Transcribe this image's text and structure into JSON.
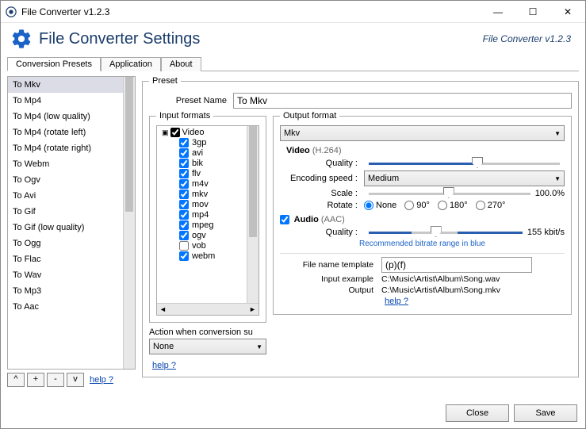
{
  "window": {
    "title": "File Converter v1.2.3",
    "minimize": "—",
    "maximize": "☐",
    "close": "✕"
  },
  "header": {
    "title": "File Converter Settings",
    "version": "File Converter v1.2.3"
  },
  "tabs": {
    "presets": "Conversion Presets",
    "application": "Application",
    "about": "About"
  },
  "presets": {
    "items": [
      "To Mkv",
      "To Mp4",
      "To Mp4 (low quality)",
      "To Mp4 (rotate left)",
      "To Mp4 (rotate right)",
      "To Webm",
      "To Ogv",
      "To Avi",
      "To Gif",
      "To Gif (low quality)",
      "To Ogg",
      "To Flac",
      "To Wav",
      "To Mp3",
      "To Aac"
    ],
    "btn_up": "^",
    "btn_add": "+",
    "btn_remove": "-",
    "btn_down": "v",
    "help": "help ?"
  },
  "preset_panel": {
    "legend": "Preset",
    "name_label": "Preset Name",
    "name_value": "To Mkv"
  },
  "input_formats": {
    "legend": "Input formats",
    "root": "Video",
    "items": [
      {
        "label": "3gp",
        "checked": true
      },
      {
        "label": "avi",
        "checked": true
      },
      {
        "label": "bik",
        "checked": true
      },
      {
        "label": "flv",
        "checked": true
      },
      {
        "label": "m4v",
        "checked": true
      },
      {
        "label": "mkv",
        "checked": true
      },
      {
        "label": "mov",
        "checked": true
      },
      {
        "label": "mp4",
        "checked": true
      },
      {
        "label": "mpeg",
        "checked": true
      },
      {
        "label": "ogv",
        "checked": true
      },
      {
        "label": "vob",
        "checked": false
      },
      {
        "label": "webm",
        "checked": true
      }
    ],
    "action_label": "Action when conversion su",
    "action_value": "None",
    "help": "help ?"
  },
  "output": {
    "legend": "Output format",
    "format_value": "Mkv",
    "video_label": "Video",
    "video_codec": "(H.264)",
    "quality_label": "Quality :",
    "encoding_label": "Encoding speed :",
    "encoding_value": "Medium",
    "scale_label": "Scale :",
    "scale_value": "100.0%",
    "rotate_label": "Rotate :",
    "rotate_options": [
      "None",
      "90°",
      "180°",
      "270°"
    ],
    "audio_label": "Audio",
    "audio_codec": "(AAC)",
    "audio_quality_label": "Quality :",
    "audio_quality_value": "155 kbit/s",
    "bitrate_note": "Recommended bitrate range in blue",
    "template_label": "File name template",
    "template_value": "(p)(f)",
    "input_example_label": "Input example",
    "input_example_value": "C:\\Music\\Artist\\Album\\Song.wav",
    "output_example_label": "Output",
    "output_example_value": "C:\\Music\\Artist\\Album\\Song.mkv",
    "help": "help ?"
  },
  "footer": {
    "close": "Close",
    "save": "Save"
  }
}
